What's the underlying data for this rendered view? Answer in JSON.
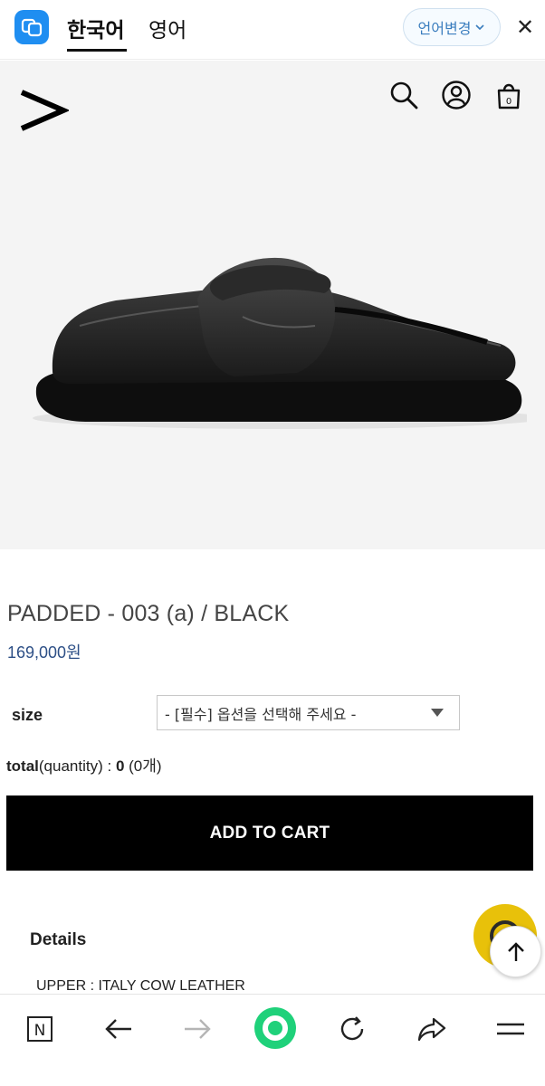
{
  "translate_bar": {
    "tab_active": "한국어",
    "tab_other": "영어",
    "lang_button": "언어변경",
    "close": "✕"
  },
  "header": {
    "icons": [
      "search-icon",
      "user-icon",
      "shopping-bag-icon"
    ]
  },
  "product": {
    "title": "PADDED - 003 (a) / BLACK",
    "price": "169,000원"
  },
  "options": {
    "size_label": "size",
    "size_placeholder": "- [필수] 옵션을 선택해 주세요 -"
  },
  "total": {
    "label": "total",
    "sublabel": "(quantity) : ",
    "amount": "0",
    "count": " (0개)"
  },
  "cart": {
    "label": "ADD TO CART"
  },
  "details": {
    "heading": "Details",
    "upper": "UPPER  : ITALY COW LEATHER"
  },
  "browser_bar": {
    "icons": [
      "naver-n-icon",
      "back-arrow-icon",
      "forward-arrow-icon",
      "home-circle-icon",
      "reload-icon",
      "share-icon",
      "menu-icon"
    ]
  },
  "colors": {
    "accent_blue": "#1f8ef1",
    "price_blue": "#2d4f86",
    "cart_bg": "#000000",
    "chat_yellow": "#e8c10a",
    "home_green": "#1fd17a"
  }
}
